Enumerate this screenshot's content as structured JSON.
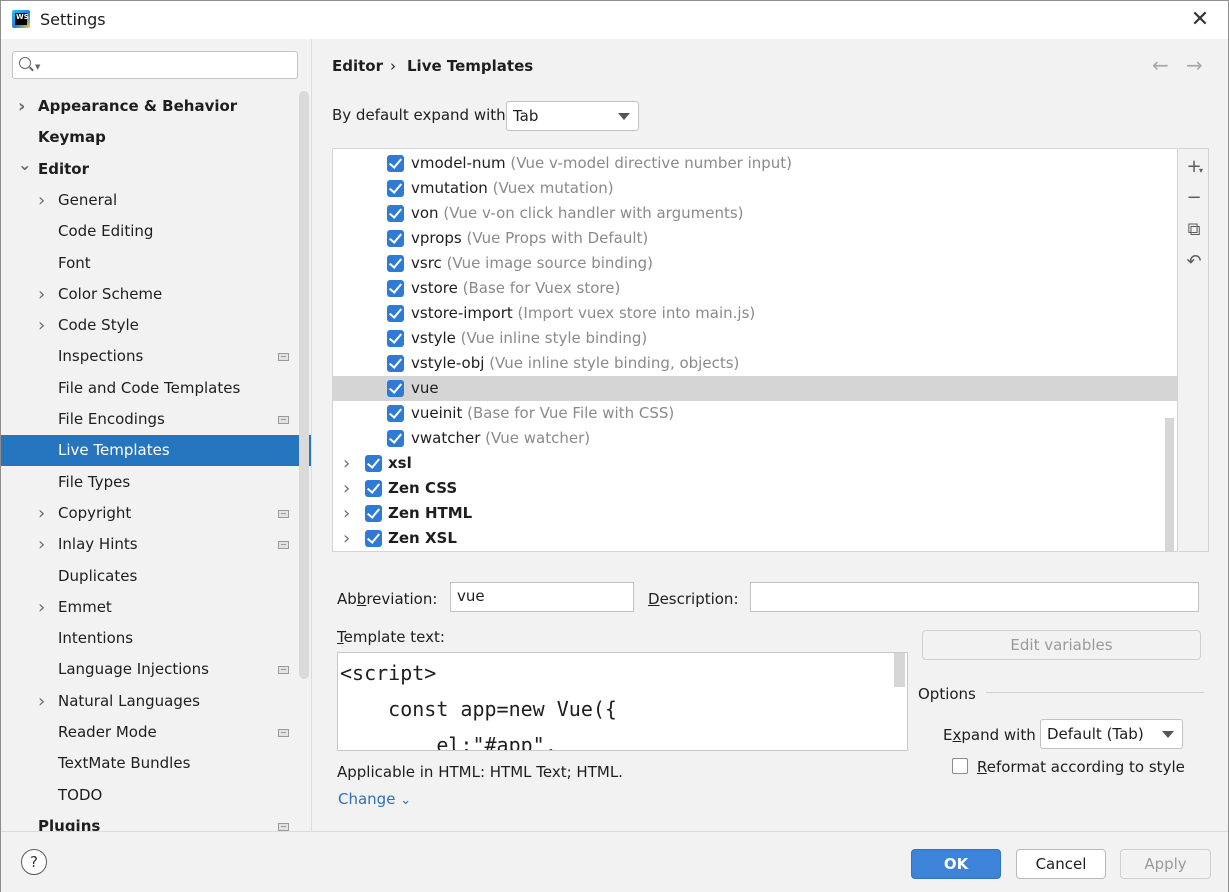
{
  "window": {
    "title": "Settings",
    "app_icon_text": "WS"
  },
  "sidebar": {
    "search_placeholder": "",
    "items": [
      {
        "label": "Appearance & Behavior",
        "level": 0,
        "bold": true,
        "expandable": true,
        "expanded": false
      },
      {
        "label": "Keymap",
        "level": 0,
        "bold": true,
        "expandable": false
      },
      {
        "label": "Editor",
        "level": 0,
        "bold": true,
        "expandable": true,
        "expanded": true
      },
      {
        "label": "General",
        "level": 1,
        "expandable": true
      },
      {
        "label": "Code Editing",
        "level": 1
      },
      {
        "label": "Font",
        "level": 1
      },
      {
        "label": "Color Scheme",
        "level": 1,
        "expandable": true
      },
      {
        "label": "Code Style",
        "level": 1,
        "expandable": true
      },
      {
        "label": "Inspections",
        "level": 1,
        "badge": true
      },
      {
        "label": "File and Code Templates",
        "level": 1
      },
      {
        "label": "File Encodings",
        "level": 1,
        "badge": true
      },
      {
        "label": "Live Templates",
        "level": 1,
        "selected": true
      },
      {
        "label": "File Types",
        "level": 1
      },
      {
        "label": "Copyright",
        "level": 1,
        "expandable": true,
        "badge": true
      },
      {
        "label": "Inlay Hints",
        "level": 1,
        "expandable": true,
        "badge": true
      },
      {
        "label": "Duplicates",
        "level": 1
      },
      {
        "label": "Emmet",
        "level": 1,
        "expandable": true
      },
      {
        "label": "Intentions",
        "level": 1
      },
      {
        "label": "Language Injections",
        "level": 1,
        "badge": true
      },
      {
        "label": "Natural Languages",
        "level": 1,
        "expandable": true
      },
      {
        "label": "Reader Mode",
        "level": 1,
        "badge": true
      },
      {
        "label": "TextMate Bundles",
        "level": 1
      },
      {
        "label": "TODO",
        "level": 1
      },
      {
        "label": "Plugins",
        "level": 0,
        "bold": true,
        "badge": true
      }
    ]
  },
  "header": {
    "breadcrumb_parent": "Editor",
    "breadcrumb_sep": "›",
    "breadcrumb_current": "Live Templates",
    "back_arrow": "←",
    "forward_arrow": "→"
  },
  "expand": {
    "label": "By default expand with",
    "value": "Tab"
  },
  "templates": [
    {
      "name": "vmodel-num",
      "desc": "(Vue v-model directive number input)",
      "checked": true
    },
    {
      "name": "vmutation",
      "desc": "(Vuex mutation)",
      "checked": true
    },
    {
      "name": "von",
      "desc": "(Vue v-on click handler with arguments)",
      "checked": true
    },
    {
      "name": "vprops",
      "desc": "(Vue Props with Default)",
      "checked": true
    },
    {
      "name": "vsrc",
      "desc": "(Vue image source binding)",
      "checked": true
    },
    {
      "name": "vstore",
      "desc": "(Base for Vuex store)",
      "checked": true
    },
    {
      "name": "vstore-import",
      "desc": "(Import vuex store into main.js)",
      "checked": true
    },
    {
      "name": "vstyle",
      "desc": "(Vue inline style binding)",
      "checked": true
    },
    {
      "name": "vstyle-obj",
      "desc": "(Vue inline style binding, objects)",
      "checked": true
    },
    {
      "name": "vue",
      "desc": "",
      "checked": true,
      "selected": true
    },
    {
      "name": "vueinit",
      "desc": "(Base for Vue File with CSS)",
      "checked": true
    },
    {
      "name": "vwatcher",
      "desc": "(Vue watcher)",
      "checked": true
    }
  ],
  "groups": [
    {
      "name": "xsl",
      "checked": true
    },
    {
      "name": "Zen CSS",
      "checked": true
    },
    {
      "name": "Zen HTML",
      "checked": true
    },
    {
      "name": "Zen XSL",
      "checked": true
    }
  ],
  "toolbar": {
    "add": "+",
    "add_caret": "▾",
    "remove": "−",
    "copy": "⧉",
    "revert": "↶"
  },
  "editor": {
    "abbreviation_label_pre": "Ab",
    "abbreviation_label_mn": "b",
    "abbreviation_label_post": "reviation:",
    "abbreviation_value": "vue",
    "description_label_mn": "D",
    "description_label_post": "escription:",
    "description_value": "",
    "template_text_label_mn": "T",
    "template_text_label_post": "emplate text:",
    "template_lines": [
      "<script>",
      "    const app=new Vue({",
      "        el:\"#app\","
    ],
    "applicable": "Applicable in HTML: HTML Text; HTML.",
    "change_link": "Change",
    "change_caret": "⌄"
  },
  "options": {
    "edit_variables": "Edit variables",
    "title": "Options",
    "expand_with_label_pre": "E",
    "expand_with_label_mn": "x",
    "expand_with_label_post": "pand with",
    "expand_with_value": "Default (Tab)",
    "reformat_label_mn": "R",
    "reformat_label_post": "eformat according to style",
    "reformat_checked": false
  },
  "footer": {
    "help": "?",
    "ok": "OK",
    "cancel": "Cancel",
    "apply": "Apply"
  }
}
